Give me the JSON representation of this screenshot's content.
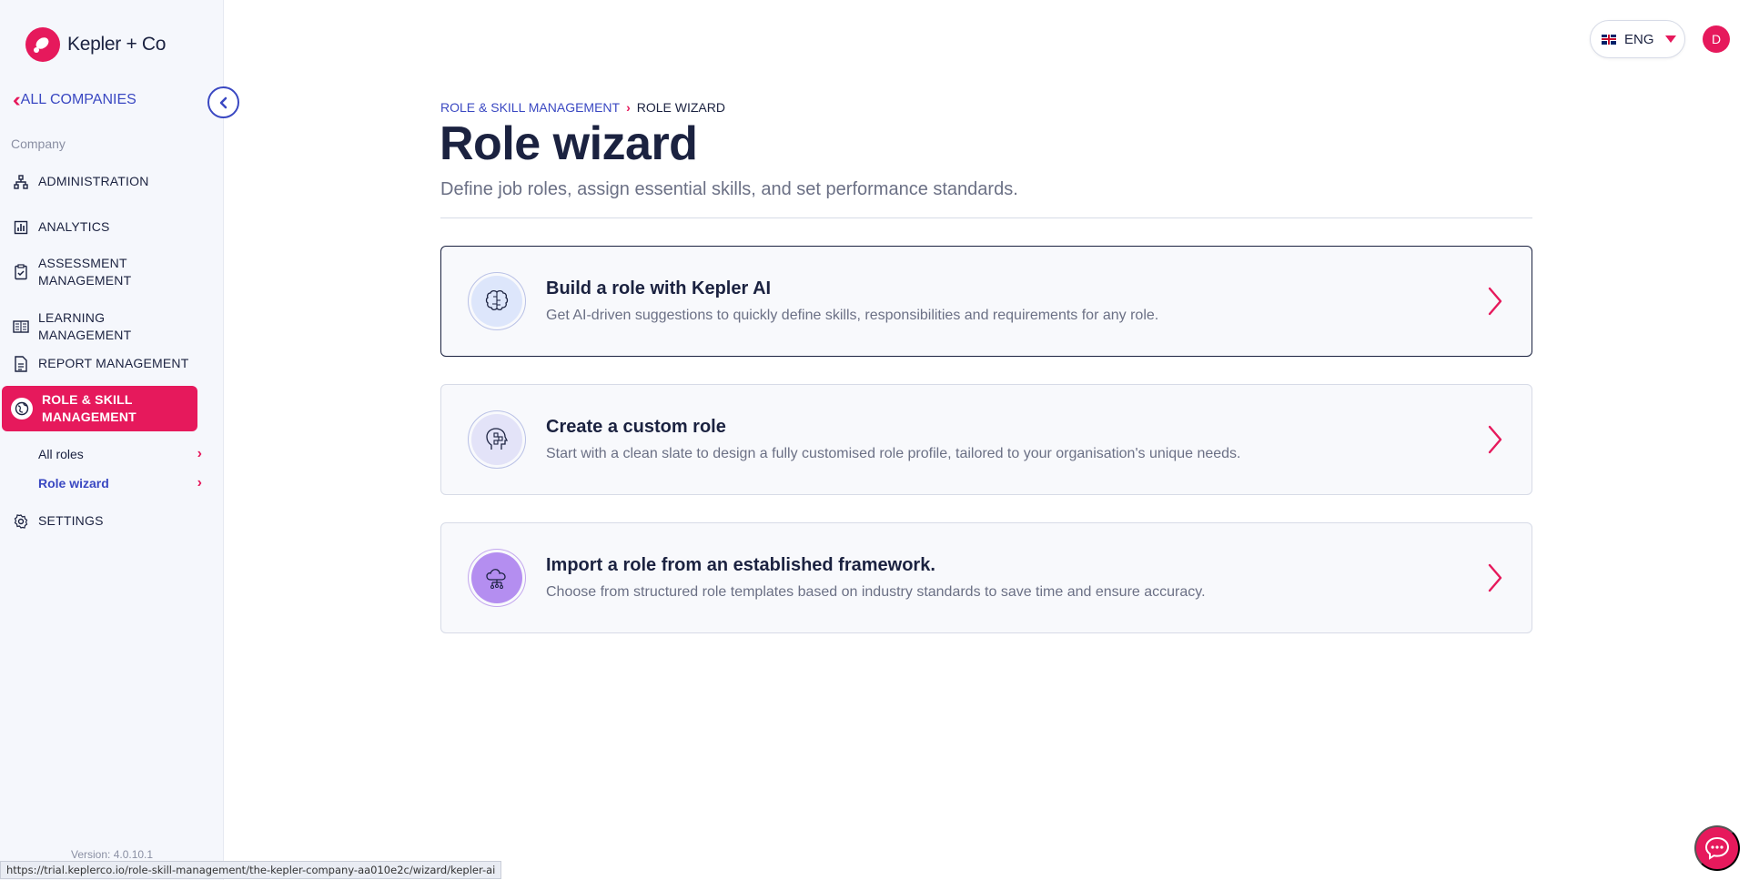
{
  "brand": {
    "name": "Kepler + Co"
  },
  "sidebar": {
    "all_companies_label": "ALL COMPANIES",
    "section_label": "Company",
    "items": [
      {
        "label": "ADMINISTRATION",
        "icon": "hierarchy-icon"
      },
      {
        "label": "ANALYTICS",
        "icon": "bar-chart-icon"
      },
      {
        "label": "ASSESSMENT\nMANAGEMENT",
        "icon": "clipboard-check-icon"
      },
      {
        "label": "LEARNING MANAGEMENT",
        "icon": "book-icon"
      },
      {
        "label": "REPORT MANAGEMENT",
        "icon": "report-icon"
      },
      {
        "label": "ROLE & SKILL\nMANAGEMENT",
        "icon": "globe-icon",
        "active": true
      },
      {
        "label": "SETTINGS",
        "icon": "gear-icon"
      }
    ],
    "sub_items": [
      {
        "label": "All roles"
      },
      {
        "label": "Role wizard",
        "current": true
      }
    ],
    "version": "Version: 4.0.10.1"
  },
  "header": {
    "language": "ENG",
    "avatar_initial": "D"
  },
  "breadcrumb": {
    "parent": "ROLE & SKILL MANAGEMENT",
    "current": "ROLE WIZARD"
  },
  "page": {
    "title": "Role wizard",
    "subtitle": "Define job roles, assign essential skills, and set performance standards."
  },
  "options": [
    {
      "title": "Build a role with Kepler AI",
      "description": "Get AI-driven suggestions to quickly define skills, responsibilities and requirements for any role.",
      "icon": "brain-icon",
      "selected": true
    },
    {
      "title": "Create a custom role",
      "description": "Start with a clean slate to design a fully customised role profile, tailored to your organisation's unique needs.",
      "icon": "head-gears-icon"
    },
    {
      "title": "Import a role from an established framework.",
      "description": "Choose from structured role templates based on industry standards to save time and ensure accuracy.",
      "icon": "cloud-network-icon"
    }
  ],
  "status_url": "https://trial.keplerco.io/role-skill-management/the-kepler-company-aa010e2c/wizard/kepler-ai",
  "colors": {
    "accent": "#e6195c",
    "link": "#3a48c2",
    "text": "#1b2240",
    "muted": "#6b7085"
  }
}
